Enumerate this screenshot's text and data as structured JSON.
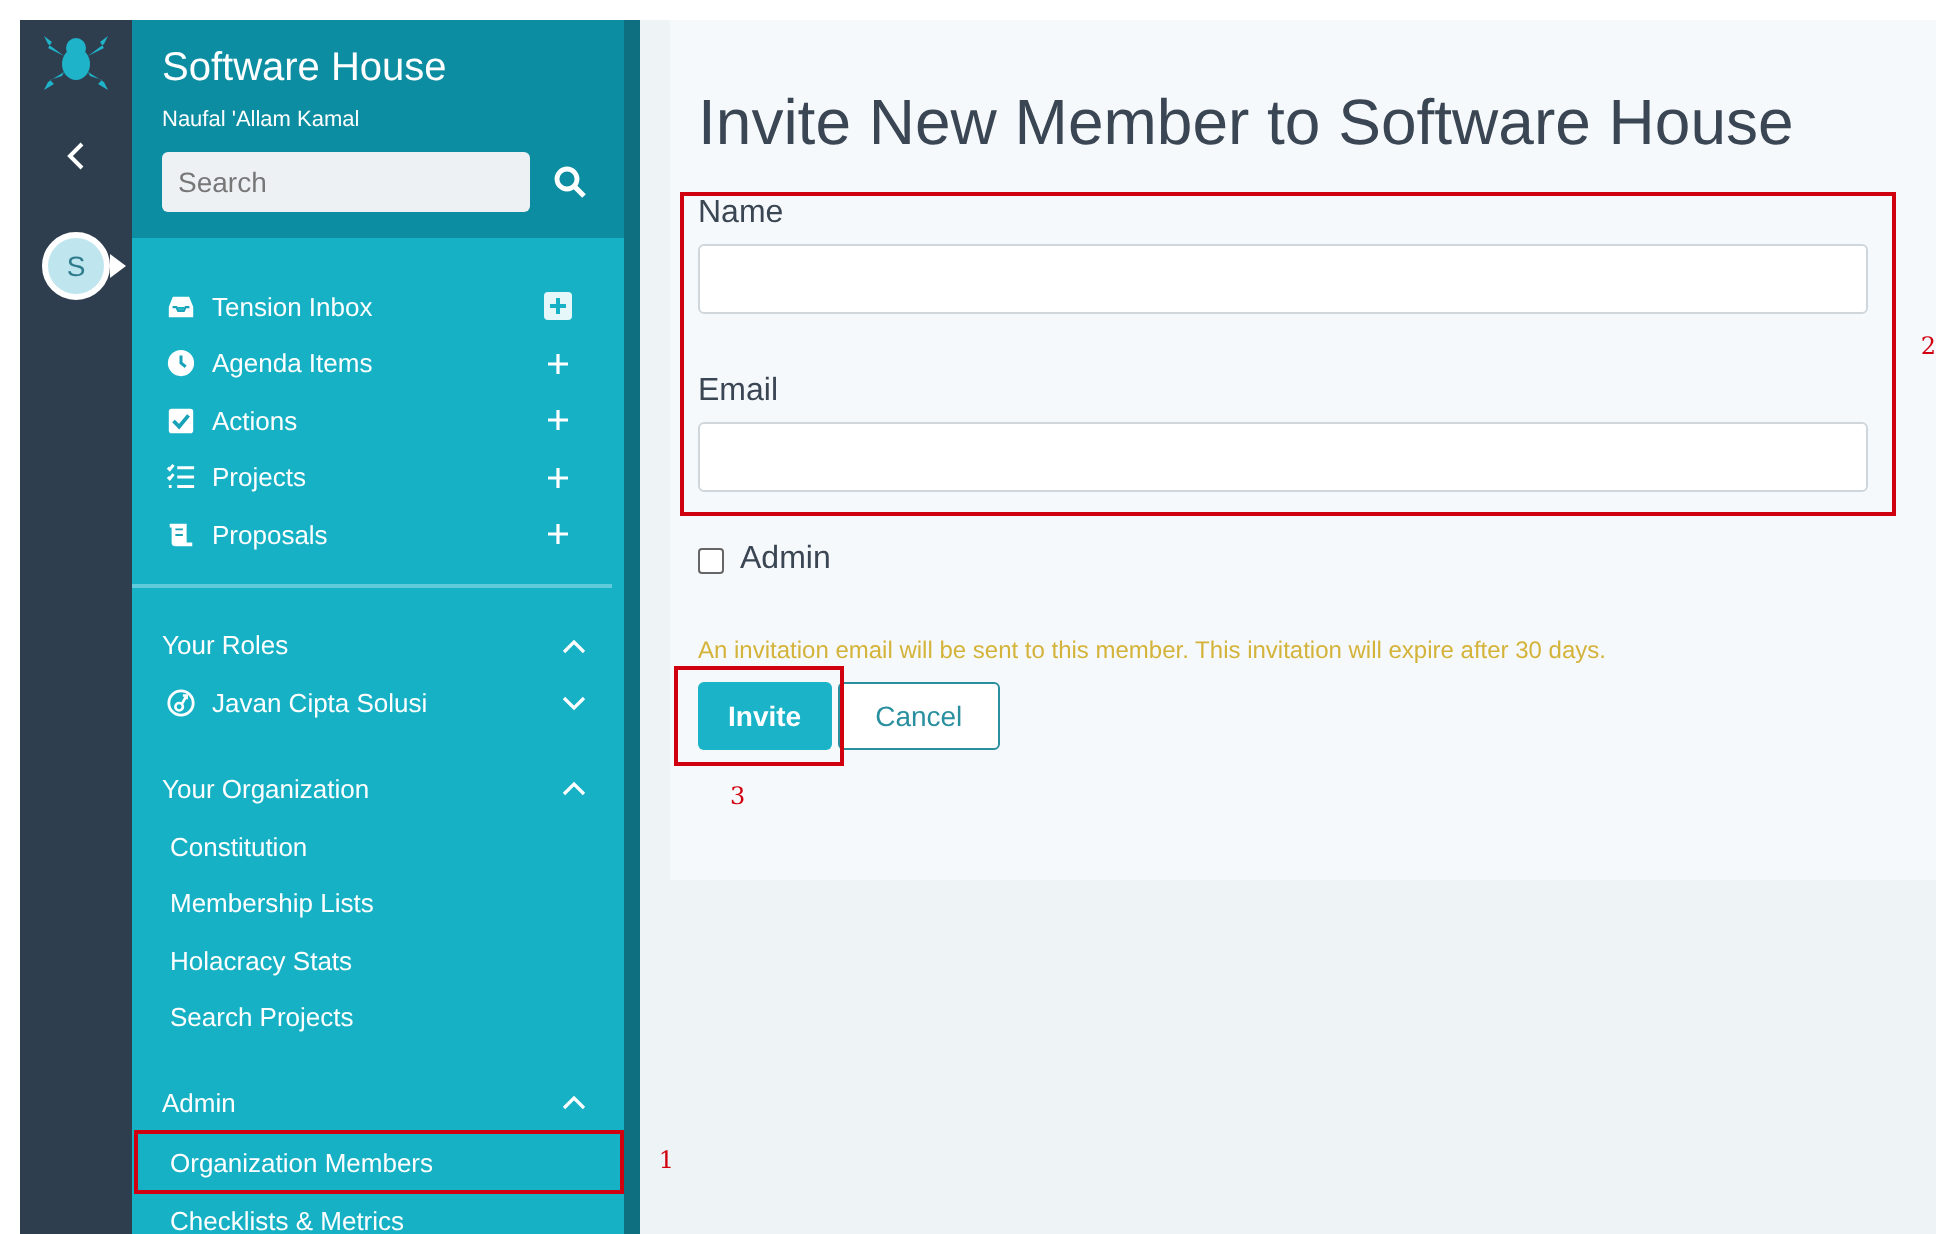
{
  "rail": {
    "avatar": "S"
  },
  "sidebar": {
    "title": "Software House",
    "user": "Naufal 'Allam Kamal",
    "search": {
      "placeholder": "Search"
    },
    "nav": [
      {
        "label": "Tension Inbox",
        "add_highlighted": true
      },
      {
        "label": "Agenda Items",
        "add_highlighted": false
      },
      {
        "label": "Actions",
        "add_highlighted": false
      },
      {
        "label": "Projects",
        "add_highlighted": false
      },
      {
        "label": "Proposals",
        "add_highlighted": false
      }
    ],
    "sections": [
      {
        "title": "Your Roles",
        "expanded": true,
        "items": [
          {
            "label": "Javan Cipta Solusi",
            "kind": "role",
            "expanded": false
          }
        ]
      },
      {
        "title": "Your Organization",
        "expanded": true,
        "items": [
          {
            "label": "Constitution",
            "kind": "link"
          },
          {
            "label": "Membership Lists",
            "kind": "link"
          },
          {
            "label": "Holacracy Stats",
            "kind": "link"
          },
          {
            "label": "Search Projects",
            "kind": "link"
          }
        ]
      },
      {
        "title": "Admin",
        "expanded": true,
        "items": [
          {
            "label": "Organization Members",
            "kind": "link",
            "annotation": "1"
          },
          {
            "label": "Checklists & Metrics",
            "kind": "link"
          }
        ]
      }
    ]
  },
  "main": {
    "title": "Invite New Member to Software House",
    "fields_annotation": "2",
    "fields": [
      {
        "label": "Name"
      },
      {
        "label": "Email"
      }
    ],
    "admin": {
      "label": "Admin",
      "checked": false
    },
    "notice": "An invitation email will be sent to this member. This invitation will expire after 30 days.",
    "buttons": [
      {
        "label": "Invite",
        "kind": "primary",
        "annotation": "3"
      },
      {
        "label": "Cancel",
        "kind": "secondary"
      }
    ]
  }
}
